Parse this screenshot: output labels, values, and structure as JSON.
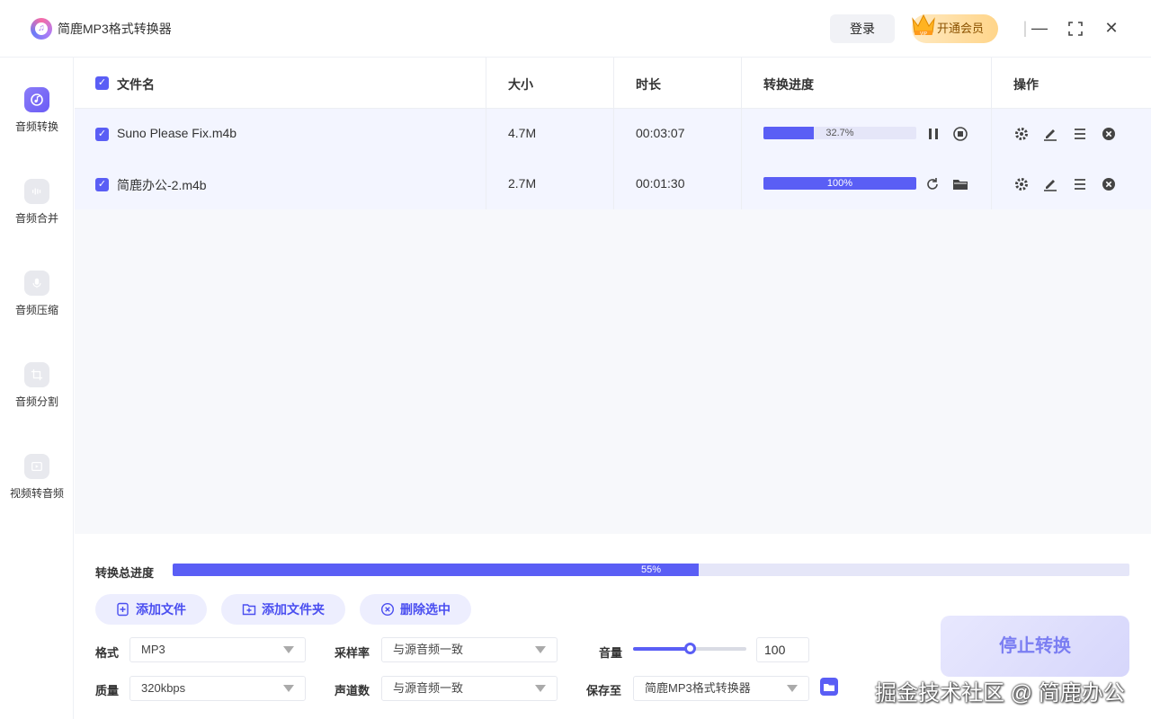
{
  "app": {
    "title": "简鹿MP3格式转换器",
    "login": "登录",
    "vip": "开通会员"
  },
  "sidebar": {
    "items": [
      {
        "label": "音频转换",
        "icon": "audio-convert-icon",
        "active": true
      },
      {
        "label": "音频合并",
        "icon": "audio-merge-icon",
        "active": false
      },
      {
        "label": "音频压缩",
        "icon": "audio-compress-icon",
        "active": false
      },
      {
        "label": "音频分割",
        "icon": "audio-split-icon",
        "active": false
      },
      {
        "label": "视频转音频",
        "icon": "video-to-audio-icon",
        "active": false
      }
    ]
  },
  "table": {
    "headers": {
      "name": "文件名",
      "size": "大小",
      "duration": "时长",
      "progress": "转换进度",
      "actions": "操作"
    },
    "rows": [
      {
        "name": "Suno Please Fix.m4b",
        "size": "4.7M",
        "duration": "00:03:07",
        "progress_text": "32.7%",
        "progress": 0.327
      },
      {
        "name": "简鹿办公-2.m4b",
        "size": "2.7M",
        "duration": "00:01:30",
        "progress_text": "100%",
        "progress": 1.0
      }
    ]
  },
  "bottom": {
    "total_label": "转换总进度",
    "total_text": "55%",
    "total": 0.55,
    "add_file": "添加文件",
    "add_folder": "添加文件夹",
    "delete_selected": "删除选中",
    "format_label": "格式",
    "format_value": "MP3",
    "quality_label": "质量",
    "quality_value": "320kbps",
    "samplerate_label": "采样率",
    "samplerate_value": "与源音频一致",
    "channels_label": "声道数",
    "channels_value": "与源音频一致",
    "volume_label": "音量",
    "volume_value": "100",
    "volume_level": 0.5,
    "saveto_label": "保存至",
    "saveto_value": "简鹿MP3格式转换器",
    "stop": "停止转换"
  },
  "watermark": "掘金技术社区 @ 简鹿办公",
  "colors": {
    "accent": "#5a5ef5",
    "vip": "#ffd58a"
  }
}
